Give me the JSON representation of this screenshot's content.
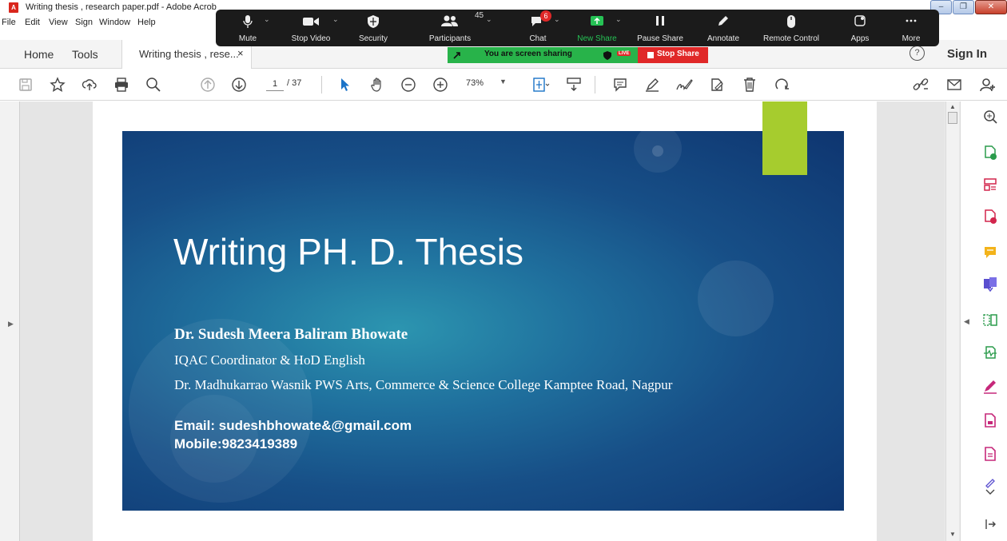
{
  "window": {
    "title": "Writing thesis , research paper.pdf - Adobe Acrob",
    "pdf_icon": "pdf-icon",
    "controls": [
      "minimize",
      "restore",
      "close"
    ]
  },
  "menu": [
    "File",
    "Edit",
    "View",
    "Sign",
    "Window",
    "Help"
  ],
  "tabs": {
    "home": "Home",
    "tools": "Tools",
    "document": "Writing thesis , rese...",
    "close": "×",
    "help": "?",
    "sign_in": "Sign In"
  },
  "toolbar": {
    "page_current": "1",
    "page_total": "/ 37",
    "zoom": "73%"
  },
  "zoom_meeting": {
    "participants_count": "45",
    "chat_badge": "6",
    "buttons": {
      "mute": "Mute",
      "stop_video": "Stop Video",
      "security": "Security",
      "participants": "Participants",
      "chat": "Chat",
      "new_share": "New Share",
      "pause_share": "Pause Share",
      "annotate": "Annotate",
      "remote_control": "Remote Control",
      "apps": "Apps",
      "more": "More"
    },
    "sharing_text": "You are screen sharing",
    "live": "LIVE",
    "stop_share": "Stop Share",
    "colors": {
      "bar": "#1b1b1b",
      "share_green": "#28b34a",
      "stop_red": "#e02828",
      "new_share": "#26c255"
    }
  },
  "slide": {
    "title": "Writing PH. D. Thesis",
    "author": "Dr. Sudesh Meera Baliram Bhowate",
    "role": "IQAC Coordinator & HoD English",
    "college": "Dr. Madhukarrao Wasnik PWS Arts, Commerce & Science College Kamptee Road, Nagpur",
    "email": "Email: sudeshbhowate&@gmail.com",
    "mobile": "Mobile:9823419389",
    "colors": {
      "accent": "#a6cc2e",
      "bg_dark": "#0e3570",
      "bg_light": "#2c95b0"
    }
  }
}
